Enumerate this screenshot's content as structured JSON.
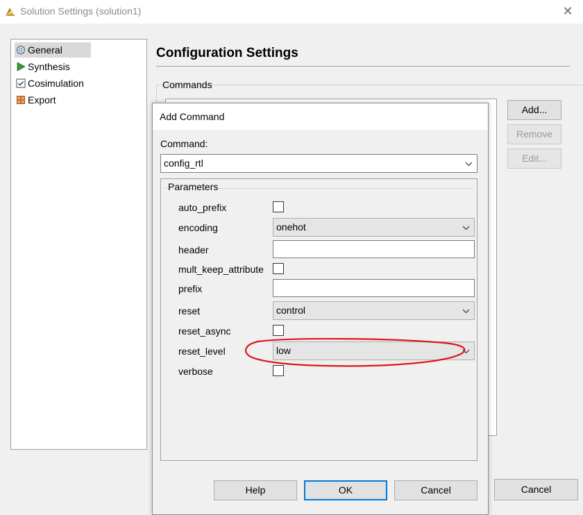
{
  "window": {
    "title": "Solution Settings (solution1)",
    "close_glyph": "✕"
  },
  "tree": {
    "items": [
      {
        "label": "General",
        "icon": "gear-icon"
      },
      {
        "label": "Synthesis",
        "icon": "play-triangle-icon"
      },
      {
        "label": "Cosimulation",
        "icon": "checkbox-icon"
      },
      {
        "label": "Export",
        "icon": "package-icon"
      }
    ]
  },
  "config": {
    "title": "Configuration Settings",
    "commands_label": "Commands",
    "buttons": {
      "add": "Add...",
      "remove": "Remove",
      "edit": "Edit..."
    },
    "cancel": "Cancel"
  },
  "dialog": {
    "title": "Add Command",
    "command_label": "Command:",
    "command_value": "config_rtl",
    "params_label": "Parameters",
    "params": {
      "auto_prefix": {
        "label": "auto_prefix",
        "type": "checkbox"
      },
      "encoding": {
        "label": "encoding",
        "type": "select",
        "value": "onehot"
      },
      "header": {
        "label": "header",
        "type": "text",
        "value": ""
      },
      "mult_keep_attribute": {
        "label": "mult_keep_attribute",
        "type": "checkbox"
      },
      "prefix": {
        "label": "prefix",
        "type": "text",
        "value": ""
      },
      "reset": {
        "label": "reset",
        "type": "select",
        "value": "control"
      },
      "reset_async": {
        "label": "reset_async",
        "type": "checkbox"
      },
      "reset_level": {
        "label": "reset_level",
        "type": "select",
        "value": "low"
      },
      "verbose": {
        "label": "verbose",
        "type": "checkbox"
      }
    },
    "buttons": {
      "help": "Help",
      "ok": "OK",
      "cancel": "Cancel"
    }
  },
  "colors": {
    "annotation": "#e0141e",
    "focus": "#0078d7"
  }
}
